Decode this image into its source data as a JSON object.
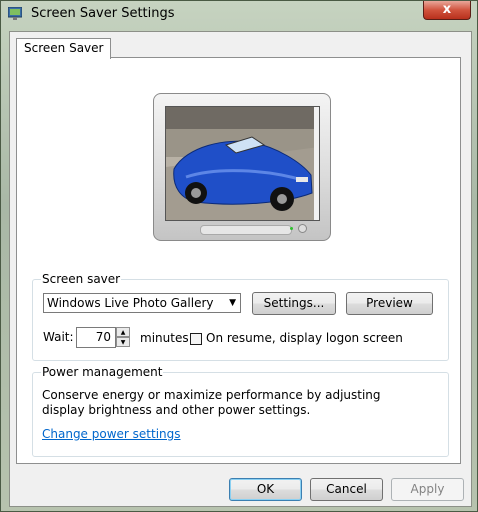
{
  "window": {
    "title": "Screen Saver Settings",
    "close_glyph": "x"
  },
  "tabs": [
    {
      "label": "Screen Saver"
    }
  ],
  "screen_saver": {
    "group_label": "Screen saver",
    "selected": "Windows Live Photo Gallery",
    "settings_label": "Settings...",
    "preview_label": "Preview",
    "wait_label": "Wait:",
    "wait_value": "70",
    "minutes_label": "minutes",
    "resume_label": "On resume, display logon screen",
    "resume_checked": false
  },
  "power": {
    "group_label": "Power management",
    "description": "Conserve energy or maximize performance by adjusting display brightness and other power settings.",
    "link_label": "Change power settings"
  },
  "footer": {
    "ok_label": "OK",
    "cancel_label": "Cancel",
    "apply_label": "Apply"
  },
  "colors": {
    "car": "#1f4fc8",
    "link": "#0066cc",
    "close": "#c83d26"
  }
}
